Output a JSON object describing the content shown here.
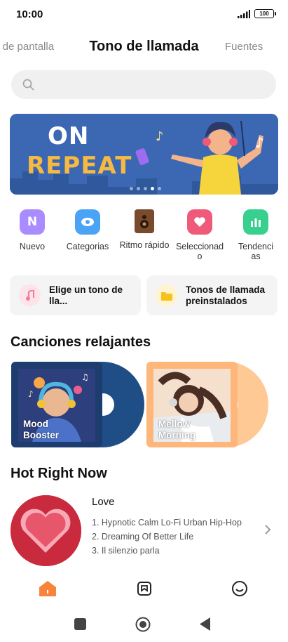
{
  "status": {
    "time": "10:00",
    "battery": "100"
  },
  "top_tabs": {
    "left": "s de pantalla",
    "center": "Tono de llamada",
    "right": "Fuentes"
  },
  "search": {
    "icon": "search-icon"
  },
  "banner": {
    "line1": "ON",
    "line2": "REPEAT",
    "page_count": 5,
    "active_index": 3
  },
  "categories": [
    {
      "label": "Nuevo",
      "icon": "new-icon",
      "color": "#9b7cff"
    },
    {
      "label": "Categorias",
      "icon": "eye-icon",
      "color": "#4aa3f5"
    },
    {
      "label": "Ritmo rápido",
      "icon": "speaker-icon",
      "color": "#8a5a3c"
    },
    {
      "label": "Seleccionad\no",
      "icon": "heart-icon",
      "color": "#f05a7a"
    },
    {
      "label": "Tendenci\nas",
      "icon": "chart-icon",
      "color": "#37d08f"
    }
  ],
  "shortcuts": [
    {
      "label": "Elige un tono de lla...",
      "icon": "music-note-icon",
      "color": "#f47a9b"
    },
    {
      "label": "Tonos de llamada\npreinstalados",
      "icon": "folder-icon",
      "color": "#f5c21b"
    }
  ],
  "relaxing": {
    "title": "Canciones relajantes",
    "albums": [
      {
        "label": "Mood\nBooster",
        "vinyl_color": "#1f4e86"
      },
      {
        "label": "Mellow\nMorning",
        "vinyl_color": "#ffc995"
      }
    ]
  },
  "hot": {
    "title": "Hot Right Now",
    "playlist_title": "Love",
    "tracks": [
      "1. Hypnotic Calm Lo-Fi Urban Hip-Hop",
      "2. Dreaming Of Better Life",
      "3. Il silenzio parla"
    ]
  },
  "bottom_nav": [
    {
      "icon": "home-icon",
      "active": true
    },
    {
      "icon": "bookmark-icon",
      "active": false
    },
    {
      "icon": "smile-icon",
      "active": false
    }
  ],
  "colors": {
    "accent": "#f7843a",
    "banner_bg": "#3b67b3",
    "heart_bg": "#c92a3d"
  }
}
